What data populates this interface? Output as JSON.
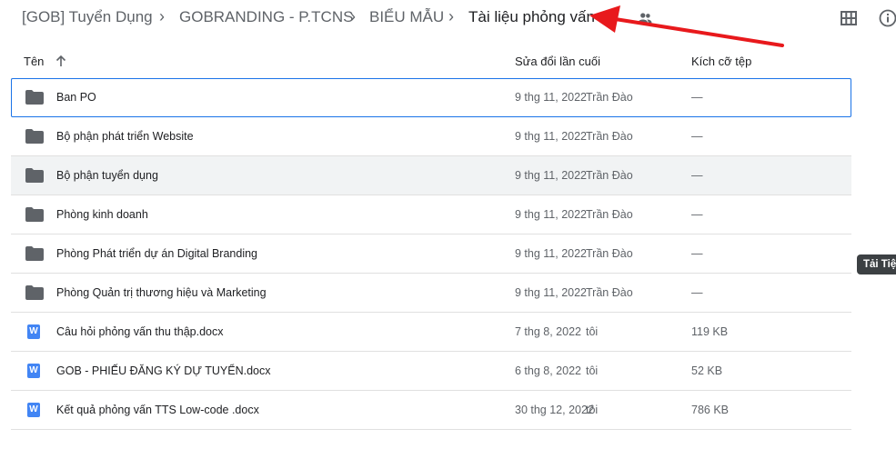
{
  "breadcrumb": {
    "items": [
      "[GOB] Tuyển Dụng",
      "GOBRANDING - P.TCNS",
      "BIỂU MẪU",
      "Tài liệu phỏng vấn"
    ],
    "separator": "›"
  },
  "columns": {
    "name": "Tên",
    "modified": "Sửa đổi lần cuối",
    "size": "Kích cỡ tệp"
  },
  "files": [
    {
      "type": "folder",
      "name": "Ban PO",
      "date": "9 thg 11, 2022",
      "owner": "Trần Đào",
      "size": "—"
    },
    {
      "type": "folder",
      "name": "Bộ phận phát triển Website",
      "date": "9 thg 11, 2022",
      "owner": "Trần Đào",
      "size": "—"
    },
    {
      "type": "folder",
      "name": "Bộ phận tuyển dụng",
      "date": "9 thg 11, 2022",
      "owner": "Trần Đào",
      "size": "—"
    },
    {
      "type": "folder",
      "name": "Phòng kinh doanh",
      "date": "9 thg 11, 2022",
      "owner": "Trần Đào",
      "size": "—"
    },
    {
      "type": "folder",
      "name": "Phòng Phát triển dự án Digital Branding",
      "date": "9 thg 11, 2022",
      "owner": "Trần Đào",
      "size": "—"
    },
    {
      "type": "folder",
      "name": "Phòng Quản trị thương hiệu và Marketing",
      "date": "9 thg 11, 2022",
      "owner": "Trần Đào",
      "size": "—"
    },
    {
      "type": "doc",
      "name": "Câu hỏi phỏng vấn thu thập.docx",
      "date": "7 thg 8, 2022",
      "owner": "tôi",
      "size": "119 KB"
    },
    {
      "type": "doc",
      "name": "GOB - PHIẾU ĐĂNG KÝ DỰ TUYỂN.docx",
      "date": "6 thg 8, 2022",
      "owner": "tôi",
      "size": "52 KB"
    },
    {
      "type": "doc",
      "name": "Kết quả phỏng vấn TTS Low-code .docx",
      "date": "30 thg 12, 2022",
      "owner": "tôi",
      "size": "786 KB"
    }
  ],
  "doc_icon_letter": "W",
  "tooltip": "Tải Tiệp",
  "colors": {
    "accent": "#1a73e8",
    "folder": "#5f6368",
    "doc": "#4285f4",
    "arrow": "#e8191c"
  }
}
